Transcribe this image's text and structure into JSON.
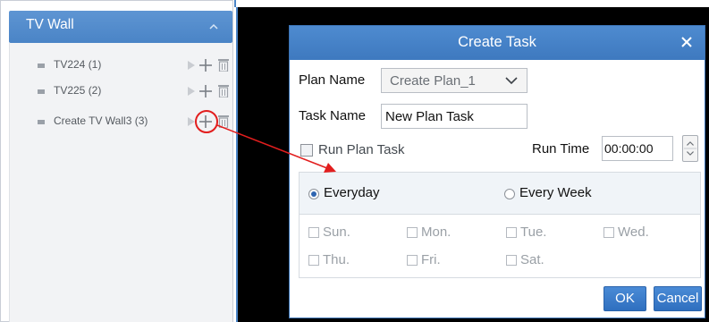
{
  "sidebar": {
    "title": "TV Wall",
    "items": [
      {
        "label": "TV224 (1)"
      },
      {
        "label": "TV225 (2)"
      },
      {
        "label": "Create TV Wall3 (3)"
      }
    ]
  },
  "dialog": {
    "title": "Create Task",
    "plan_name_label": "Plan Name",
    "plan_name_value": "Create Plan_1",
    "task_name_label": "Task Name",
    "task_name_value": "New Plan Task",
    "run_plan_task_label": "Run Plan Task",
    "run_time_label": "Run Time",
    "run_time_value": "00:00:00",
    "everyday_label": "Everyday",
    "every_week_label": "Every Week",
    "days": [
      "Sun.",
      "Mon.",
      "Tue.",
      "Wed.",
      "Thu.",
      "Fri.",
      "Sat."
    ],
    "ok_label": "OK",
    "cancel_label": "Cancel"
  },
  "colors": {
    "accent": "#4a84c6",
    "highlight": "#e21e1e"
  }
}
